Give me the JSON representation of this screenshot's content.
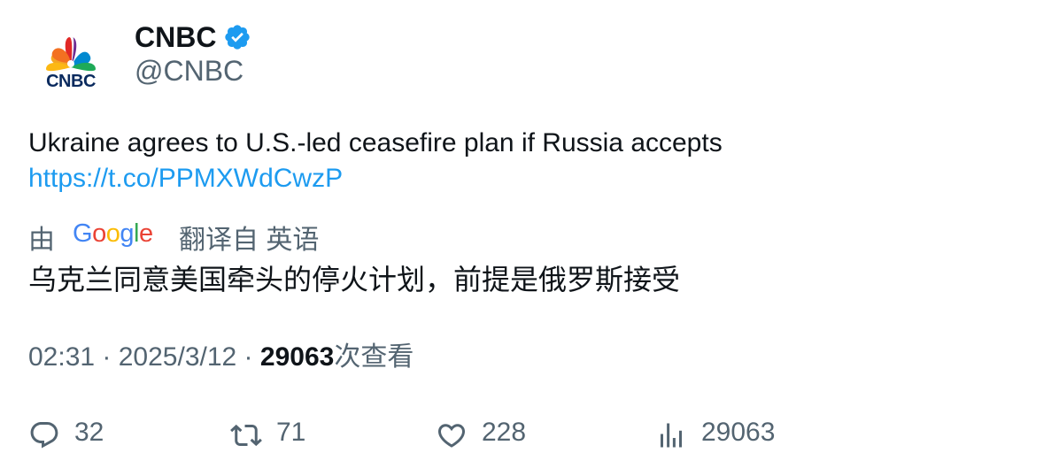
{
  "author": {
    "display_name": "CNBC",
    "handle": "@CNBC",
    "verified": true,
    "logo_text": "CNBC"
  },
  "tweet": {
    "text": "Ukraine agrees to U.S.-led ceasefire plan if Russia accepts",
    "link": "https://t.co/PPMXWdCwzP"
  },
  "translation": {
    "prefix": "由",
    "provider": "Google",
    "suffix": "翻译自 英语",
    "text": "乌克兰同意美国牵头的停火计划，前提是俄罗斯接受"
  },
  "meta": {
    "time": "02:31",
    "separator": " · ",
    "date": "2025/3/12",
    "views_count": "29063",
    "views_label": "次查看"
  },
  "actions": {
    "replies": "32",
    "retweets": "71",
    "likes": "228",
    "views": "29063"
  },
  "colors": {
    "link": "#1d9bf0",
    "secondary_text": "#536471",
    "verified": "#1d9bf0"
  }
}
